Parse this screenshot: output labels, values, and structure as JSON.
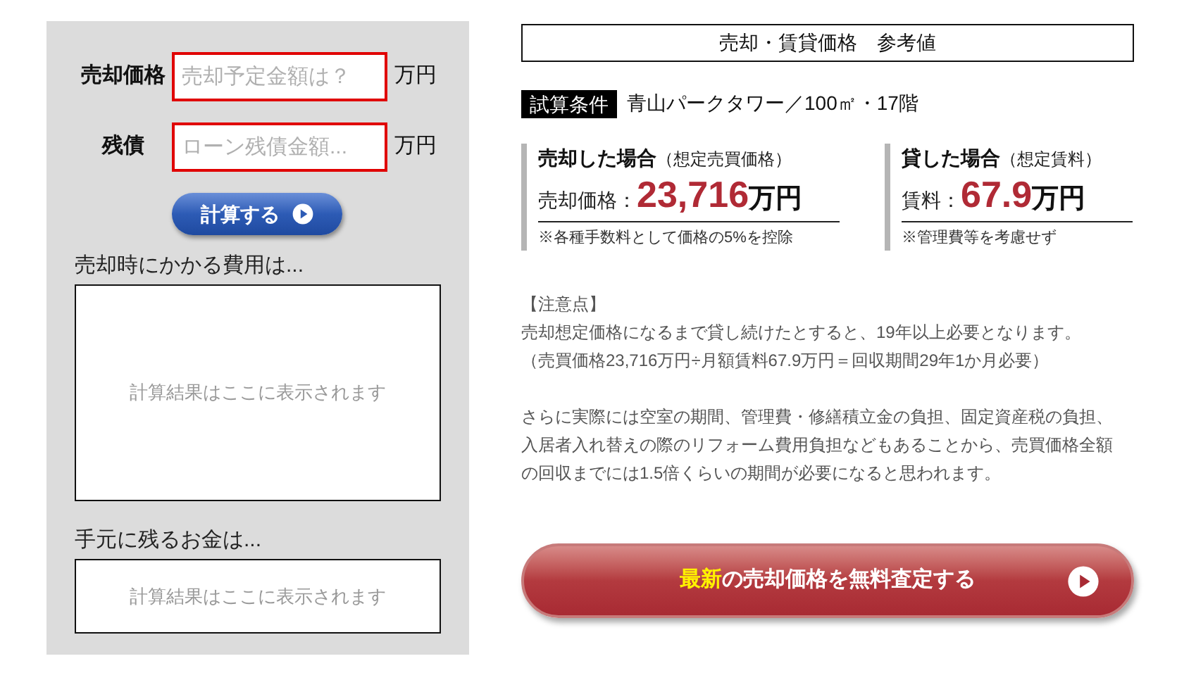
{
  "form": {
    "fields": [
      {
        "label": "売却価格",
        "placeholder": "売却予定金額は？",
        "unit": "万円"
      },
      {
        "label": "残債",
        "placeholder": "ローン残債金額...",
        "unit": "万円"
      }
    ],
    "calculate_button": "計算する",
    "results": [
      {
        "label": "売却時にかかる費用は...",
        "placeholder": "計算結果はここに表示されます"
      },
      {
        "label": "手元に残るお金は...",
        "placeholder": "計算結果はここに表示されます"
      }
    ]
  },
  "reference": {
    "title": "売却・賃貸価格　参考値",
    "condition_label": "試算条件",
    "condition": "青山パークタワー／100㎡・17階",
    "cards": [
      {
        "title": "売却した場合",
        "subtitle": "（想定売買価格）",
        "label": "売却価格：",
        "value": "23,716",
        "unit": "万円",
        "note": "※各種手数料として価格の5%を控除"
      },
      {
        "title": "貸した場合",
        "subtitle": "（想定賃料）",
        "label": "賃料：",
        "value": "67.9",
        "unit": "万円",
        "note": "※管理費等を考慮せず"
      }
    ],
    "notes": [
      "【注意点】",
      "売却想定価格になるまで貸し続けたとすると、19年以上必要となります。",
      "（売買価格23,716万円÷月額賃料67.9万円＝回収期間29年1か月必要）"
    ],
    "remarks": "さらに実際には空室の期間、管理費・修繕積立金の負担、固定資産税の負担、入居者入れ替えの際のリフォーム費用負担などもあることから、売買価格全額の回収までには1.5倍くらいの期間が必要になると思われます。",
    "cta": {
      "highlight": "最新",
      "text": "の売却価格を無料査定する"
    }
  }
}
